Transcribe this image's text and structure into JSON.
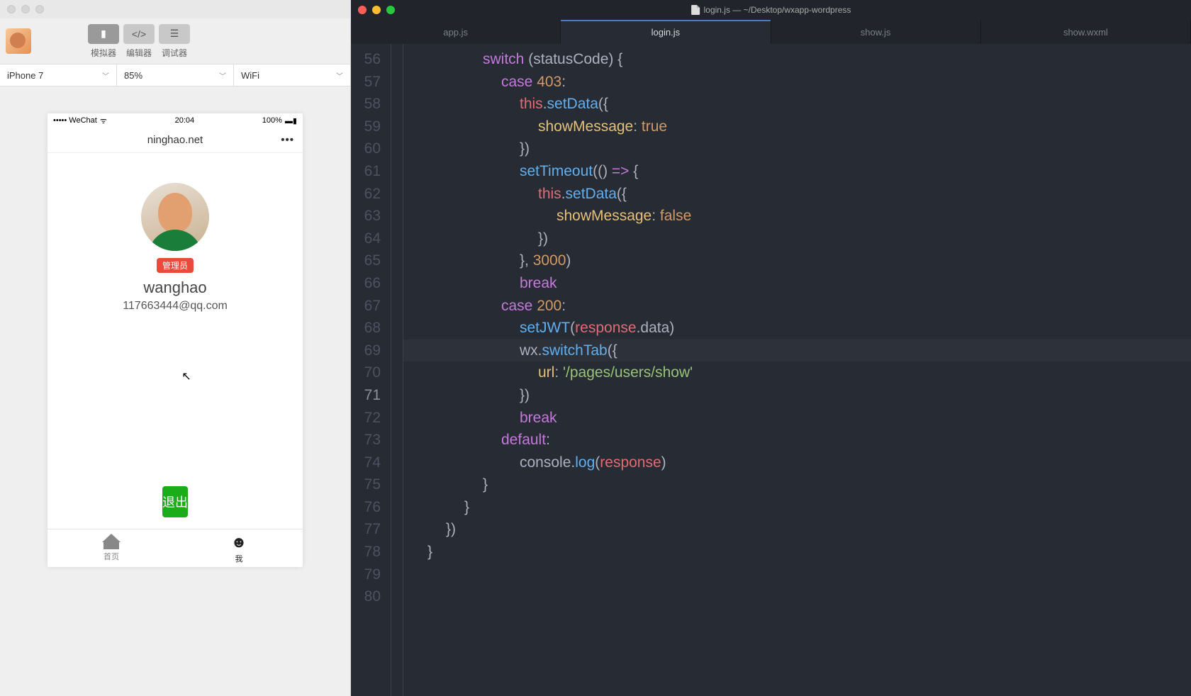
{
  "devtools": {
    "toolbar": {
      "simulator": "模拟器",
      "editor": "编辑器",
      "debugger": "调试器"
    },
    "selects": {
      "device": "iPhone 7",
      "zoom": "85%",
      "network": "WiFi"
    }
  },
  "phone": {
    "status_left": "••••• WeChat",
    "status_time": "20:04",
    "status_right": "100%",
    "nav_title": "ninghao.net",
    "badge": "管理员",
    "username": "wanghao",
    "email": "117663444@qq.com",
    "logout": "退出",
    "tab_home": "首页",
    "tab_me": "我"
  },
  "editor": {
    "window_title": "login.js — ~/Desktop/wxapp-wordpress",
    "tabs": [
      "app.js",
      "login.js",
      "show.js",
      "show.wxml"
    ],
    "active_tab": 1,
    "active_line": 71,
    "first_line": 56,
    "code": [
      {
        "n": 56,
        "i": 4,
        "t": []
      },
      {
        "n": 57,
        "i": 4,
        "t": [
          {
            "c": "kw",
            "s": "switch"
          },
          {
            "c": "punc",
            "s": " ("
          },
          {
            "c": "pname",
            "s": "statusCode"
          },
          {
            "c": "punc",
            "s": ") {"
          }
        ]
      },
      {
        "n": 58,
        "i": 5,
        "t": [
          {
            "c": "kw",
            "s": "case"
          },
          {
            "c": "punc",
            "s": " "
          },
          {
            "c": "num",
            "s": "403"
          },
          {
            "c": "punc",
            "s": ":"
          }
        ]
      },
      {
        "n": 59,
        "i": 6,
        "t": [
          {
            "c": "this",
            "s": "this"
          },
          {
            "c": "dot",
            "s": "."
          },
          {
            "c": "fn",
            "s": "setData"
          },
          {
            "c": "punc",
            "s": "({"
          }
        ]
      },
      {
        "n": 60,
        "i": 7,
        "t": [
          {
            "c": "prop",
            "s": "showMessage"
          },
          {
            "c": "punc",
            "s": ": "
          },
          {
            "c": "bool",
            "s": "true"
          }
        ]
      },
      {
        "n": 61,
        "i": 6,
        "t": [
          {
            "c": "punc",
            "s": "})"
          }
        ]
      },
      {
        "n": 62,
        "i": 6,
        "t": []
      },
      {
        "n": 63,
        "i": 6,
        "t": [
          {
            "c": "fn",
            "s": "setTimeout"
          },
          {
            "c": "punc",
            "s": "(() "
          },
          {
            "c": "kw",
            "s": "=>"
          },
          {
            "c": "punc",
            "s": " {"
          }
        ]
      },
      {
        "n": 64,
        "i": 7,
        "t": [
          {
            "c": "this",
            "s": "this"
          },
          {
            "c": "dot",
            "s": "."
          },
          {
            "c": "fn",
            "s": "setData"
          },
          {
            "c": "punc",
            "s": "({"
          }
        ]
      },
      {
        "n": 65,
        "i": 8,
        "t": [
          {
            "c": "prop",
            "s": "showMessage"
          },
          {
            "c": "punc",
            "s": ": "
          },
          {
            "c": "bool",
            "s": "false"
          }
        ]
      },
      {
        "n": 66,
        "i": 7,
        "t": [
          {
            "c": "punc",
            "s": "})"
          }
        ]
      },
      {
        "n": 67,
        "i": 6,
        "t": [
          {
            "c": "punc",
            "s": "}, "
          },
          {
            "c": "num",
            "s": "3000"
          },
          {
            "c": "punc",
            "s": ")"
          }
        ]
      },
      {
        "n": 68,
        "i": 6,
        "t": [
          {
            "c": "kw",
            "s": "break"
          }
        ]
      },
      {
        "n": 69,
        "i": 5,
        "t": [
          {
            "c": "kw",
            "s": "case"
          },
          {
            "c": "punc",
            "s": " "
          },
          {
            "c": "num",
            "s": "200"
          },
          {
            "c": "punc",
            "s": ":"
          }
        ]
      },
      {
        "n": 70,
        "i": 6,
        "t": [
          {
            "c": "fn",
            "s": "setJWT"
          },
          {
            "c": "punc",
            "s": "("
          },
          {
            "c": "var",
            "s": "response"
          },
          {
            "c": "dot",
            "s": "."
          },
          {
            "c": "pname",
            "s": "data"
          },
          {
            "c": "punc",
            "s": ")"
          }
        ]
      },
      {
        "n": 71,
        "i": 6,
        "t": [
          {
            "c": "pname",
            "s": "wx"
          },
          {
            "c": "dot",
            "s": "."
          },
          {
            "c": "fn",
            "s": "switchTab"
          },
          {
            "c": "punc",
            "s": "({"
          }
        ]
      },
      {
        "n": 72,
        "i": 7,
        "t": [
          {
            "c": "prop",
            "s": "url"
          },
          {
            "c": "punc",
            "s": ": "
          },
          {
            "c": "str",
            "s": "'/pages/users/show'"
          }
        ]
      },
      {
        "n": 73,
        "i": 6,
        "t": [
          {
            "c": "punc",
            "s": "})"
          }
        ]
      },
      {
        "n": 74,
        "i": 6,
        "t": [
          {
            "c": "kw",
            "s": "break"
          }
        ]
      },
      {
        "n": 75,
        "i": 5,
        "t": [
          {
            "c": "kw",
            "s": "default"
          },
          {
            "c": "punc",
            "s": ":"
          }
        ]
      },
      {
        "n": 76,
        "i": 6,
        "t": [
          {
            "c": "pname",
            "s": "console"
          },
          {
            "c": "dot",
            "s": "."
          },
          {
            "c": "fn",
            "s": "log"
          },
          {
            "c": "punc",
            "s": "("
          },
          {
            "c": "var",
            "s": "response"
          },
          {
            "c": "punc",
            "s": ")"
          }
        ]
      },
      {
        "n": 77,
        "i": 4,
        "t": [
          {
            "c": "punc",
            "s": "}"
          }
        ]
      },
      {
        "n": 78,
        "i": 3,
        "t": [
          {
            "c": "punc",
            "s": "}"
          }
        ]
      },
      {
        "n": 79,
        "i": 2,
        "t": [
          {
            "c": "punc",
            "s": "})"
          }
        ]
      },
      {
        "n": 80,
        "i": 1,
        "t": [
          {
            "c": "punc",
            "s": "}"
          }
        ]
      }
    ]
  }
}
